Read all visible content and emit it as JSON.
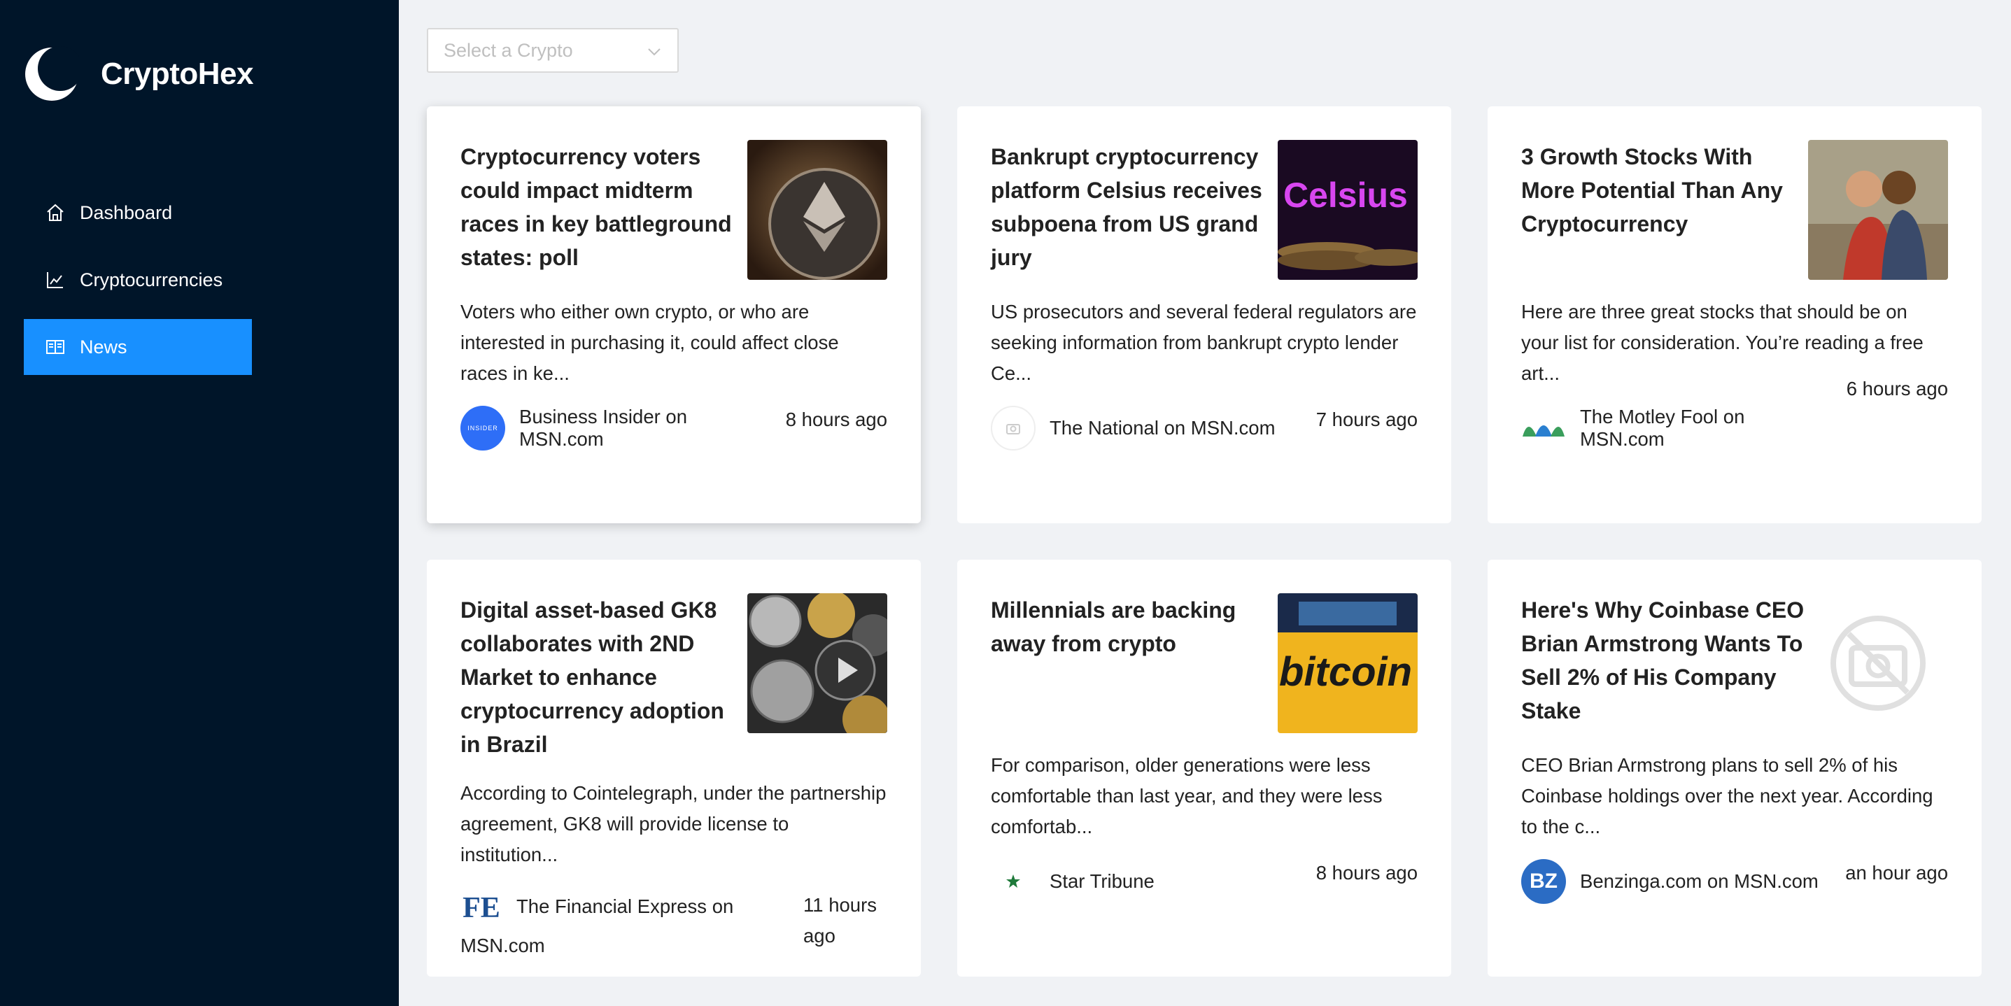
{
  "app": {
    "name": "CryptoHex"
  },
  "sidebar": {
    "items": [
      {
        "label": "Dashboard",
        "icon": "home-icon",
        "active": false
      },
      {
        "label": "Cryptocurrencies",
        "icon": "chart-icon",
        "active": false
      },
      {
        "label": "News",
        "icon": "book-icon",
        "active": true
      }
    ]
  },
  "filter": {
    "placeholder": "Select a Crypto"
  },
  "colors": {
    "sidebar_bg": "#001529",
    "accent": "#1890ff",
    "page_bg": "#f0f2f5"
  },
  "news": [
    {
      "title": "Cryptocurrency voters could impact midterm races in key battleground states: poll",
      "description": "Voters who either own crypto, or who are interested in purchasing it, could affect close races in ke...",
      "provider": "Business Insider on MSN.com",
      "provider_icon_text": "INSIDER",
      "time": "8 hours ago"
    },
    {
      "title": "Bankrupt cryptocurrency platform Celsius receives subpoena from US grand jury",
      "description": "US prosecutors and several federal regulators are seeking information from bankrupt crypto lender Ce...",
      "provider": "The National on MSN.com",
      "thumb_text": "Celsius",
      "time": "7 hours ago"
    },
    {
      "title": "3 Growth Stocks With More Potential Than Any Cryptocurrency",
      "description": "Here are three great stocks that should be on your list for consideration. You’re reading a free art...",
      "provider": "The Motley Fool on MSN.com",
      "time": "6 hours ago"
    },
    {
      "title": "Digital asset-based GK8 collaborates with 2ND Market to enhance cryptocurrency adoption in Brazil",
      "description": "According to Cointelegraph, under the partnership agreement, GK8 will provide license to institution...",
      "provider": "The Financial Express on MSN.com",
      "provider_icon_text": "FE",
      "time": "11 hours ago"
    },
    {
      "title": "Millennials are backing away from crypto",
      "description": "For comparison, older generations were less comfortable than last year, and they were less comfortab...",
      "provider": "Star Tribune",
      "thumb_text": "bitcoin",
      "time": "8 hours ago"
    },
    {
      "title": "Here's Why Coinbase CEO Brian Armstrong Wants To Sell 2% of His Company Stake",
      "description": "CEO Brian Armstrong plans to sell 2% of his Coinbase holdings over the next year. According to the c...",
      "provider": "Benzinga.com on MSN.com",
      "provider_icon_text": "BZ",
      "time": "an hour ago"
    }
  ]
}
